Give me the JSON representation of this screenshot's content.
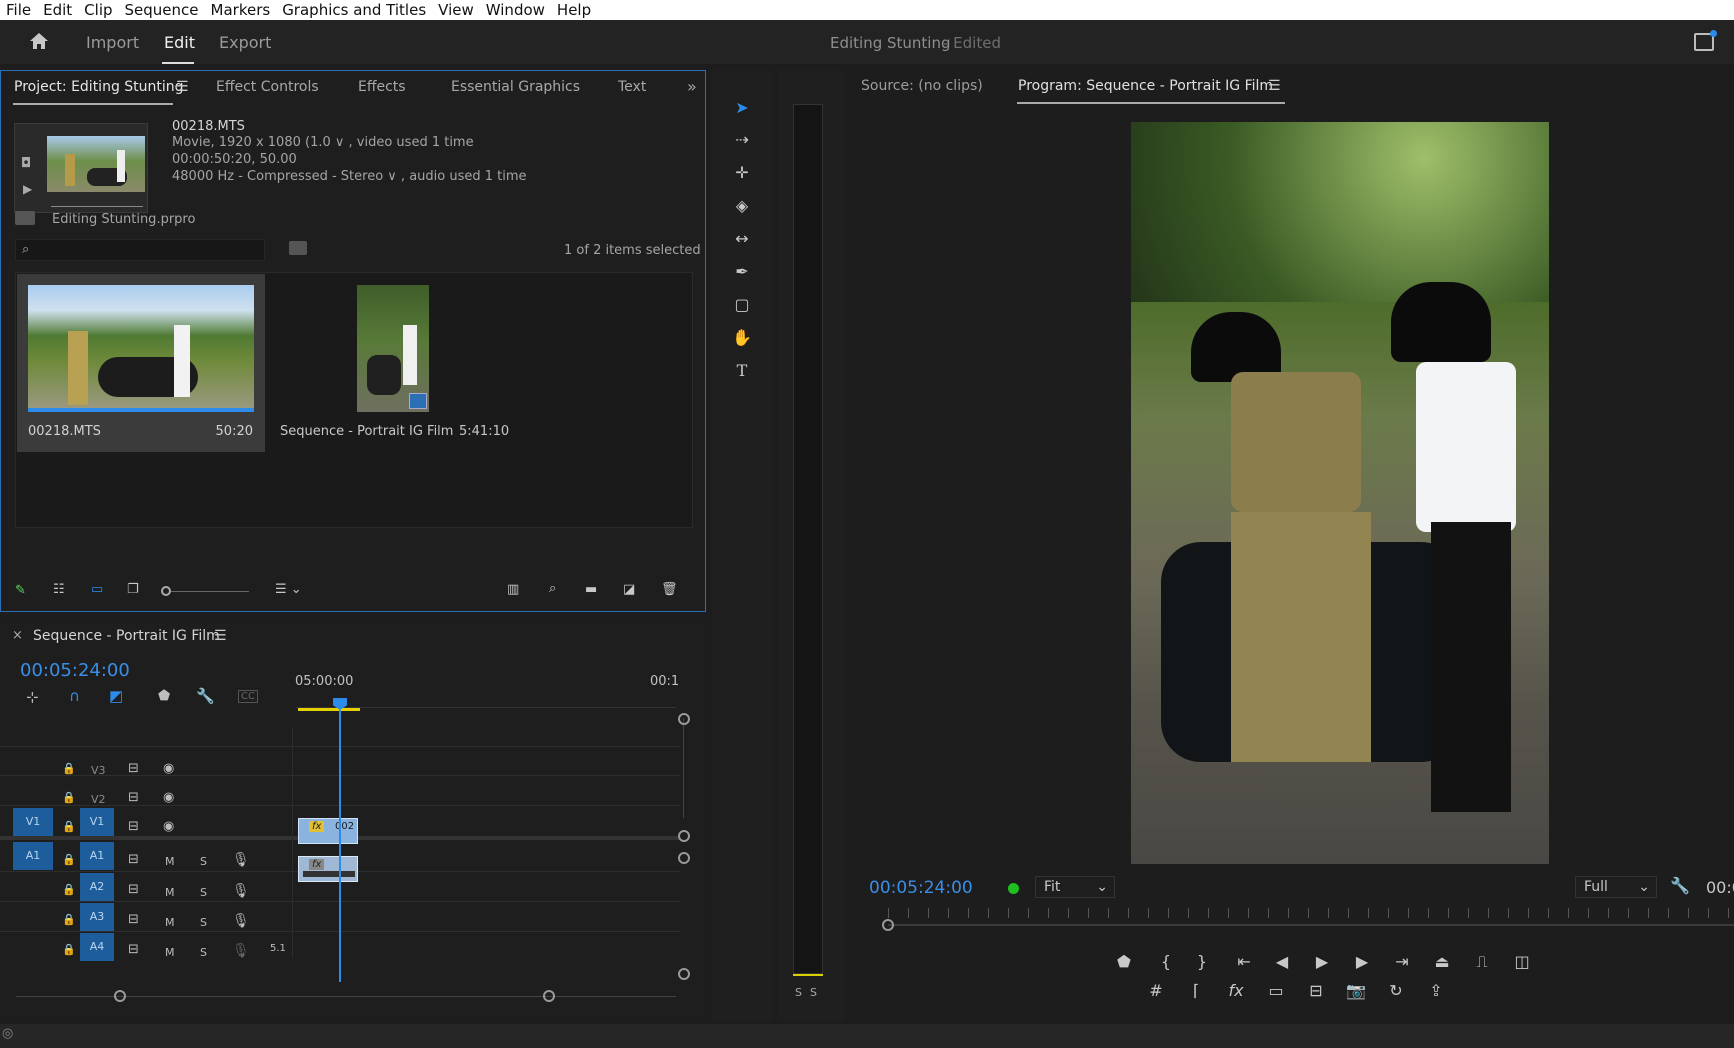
{
  "menu": [
    "File",
    "Edit",
    "Clip",
    "Sequence",
    "Markers",
    "Graphics and Titles",
    "View",
    "Window",
    "Help"
  ],
  "header": {
    "import": "Import",
    "edit": "Edit",
    "export": "Export",
    "title": "Editing Stunting",
    "edited": "- Edited"
  },
  "project_panel": {
    "tabs": [
      "Project: Editing Stunting",
      "Effect Controls",
      "Effects",
      "Essential Graphics",
      "Text"
    ],
    "clip_name": "00218.MTS",
    "clip_info": [
      "Movie, 1920 x 1080 (1.0 ∨ , video used 1 time",
      "00:00:50:20, 50.00",
      "48000 Hz - Compressed - Stereo ∨ , audio used 1 time"
    ],
    "project_file": "Editing Stunting.prpro",
    "search_placeholder": "",
    "selection_status": "1 of 2 items selected",
    "items": [
      {
        "name": "00218.MTS",
        "duration": "50:20"
      },
      {
        "name": "Sequence - Portrait IG Film",
        "duration": "5:41:10"
      }
    ]
  },
  "timeline": {
    "title": "Sequence - Portrait IG Film",
    "timecode": "00:05:24:00",
    "ruler_labels": [
      "05:00:00",
      "00:1"
    ],
    "video_tracks": [
      "V3",
      "V2",
      "V1"
    ],
    "audio_tracks": [
      "A1",
      "A2",
      "A3",
      "A4"
    ],
    "source_v": "V1",
    "source_a": "A1",
    "m_label": "M",
    "s_label": "S",
    "channel_label": "5.1",
    "clip_label": "002",
    "fx_label": "fx"
  },
  "source_monitor": {
    "label": "Source: (no clips)"
  },
  "program_monitor": {
    "label": "Program: Sequence - Portrait IG Film",
    "timecode": "00:05:24:00",
    "fit": "Fit",
    "quality": "Full",
    "end_timecode": "00:0"
  },
  "audio_meter": {
    "labels": [
      "S",
      "S"
    ]
  },
  "colors": {
    "accent": "#2d8ceb",
    "timecode": "#3a8ee6",
    "panel": "#1e1e1e",
    "selected_track": "#1d5d9b"
  }
}
